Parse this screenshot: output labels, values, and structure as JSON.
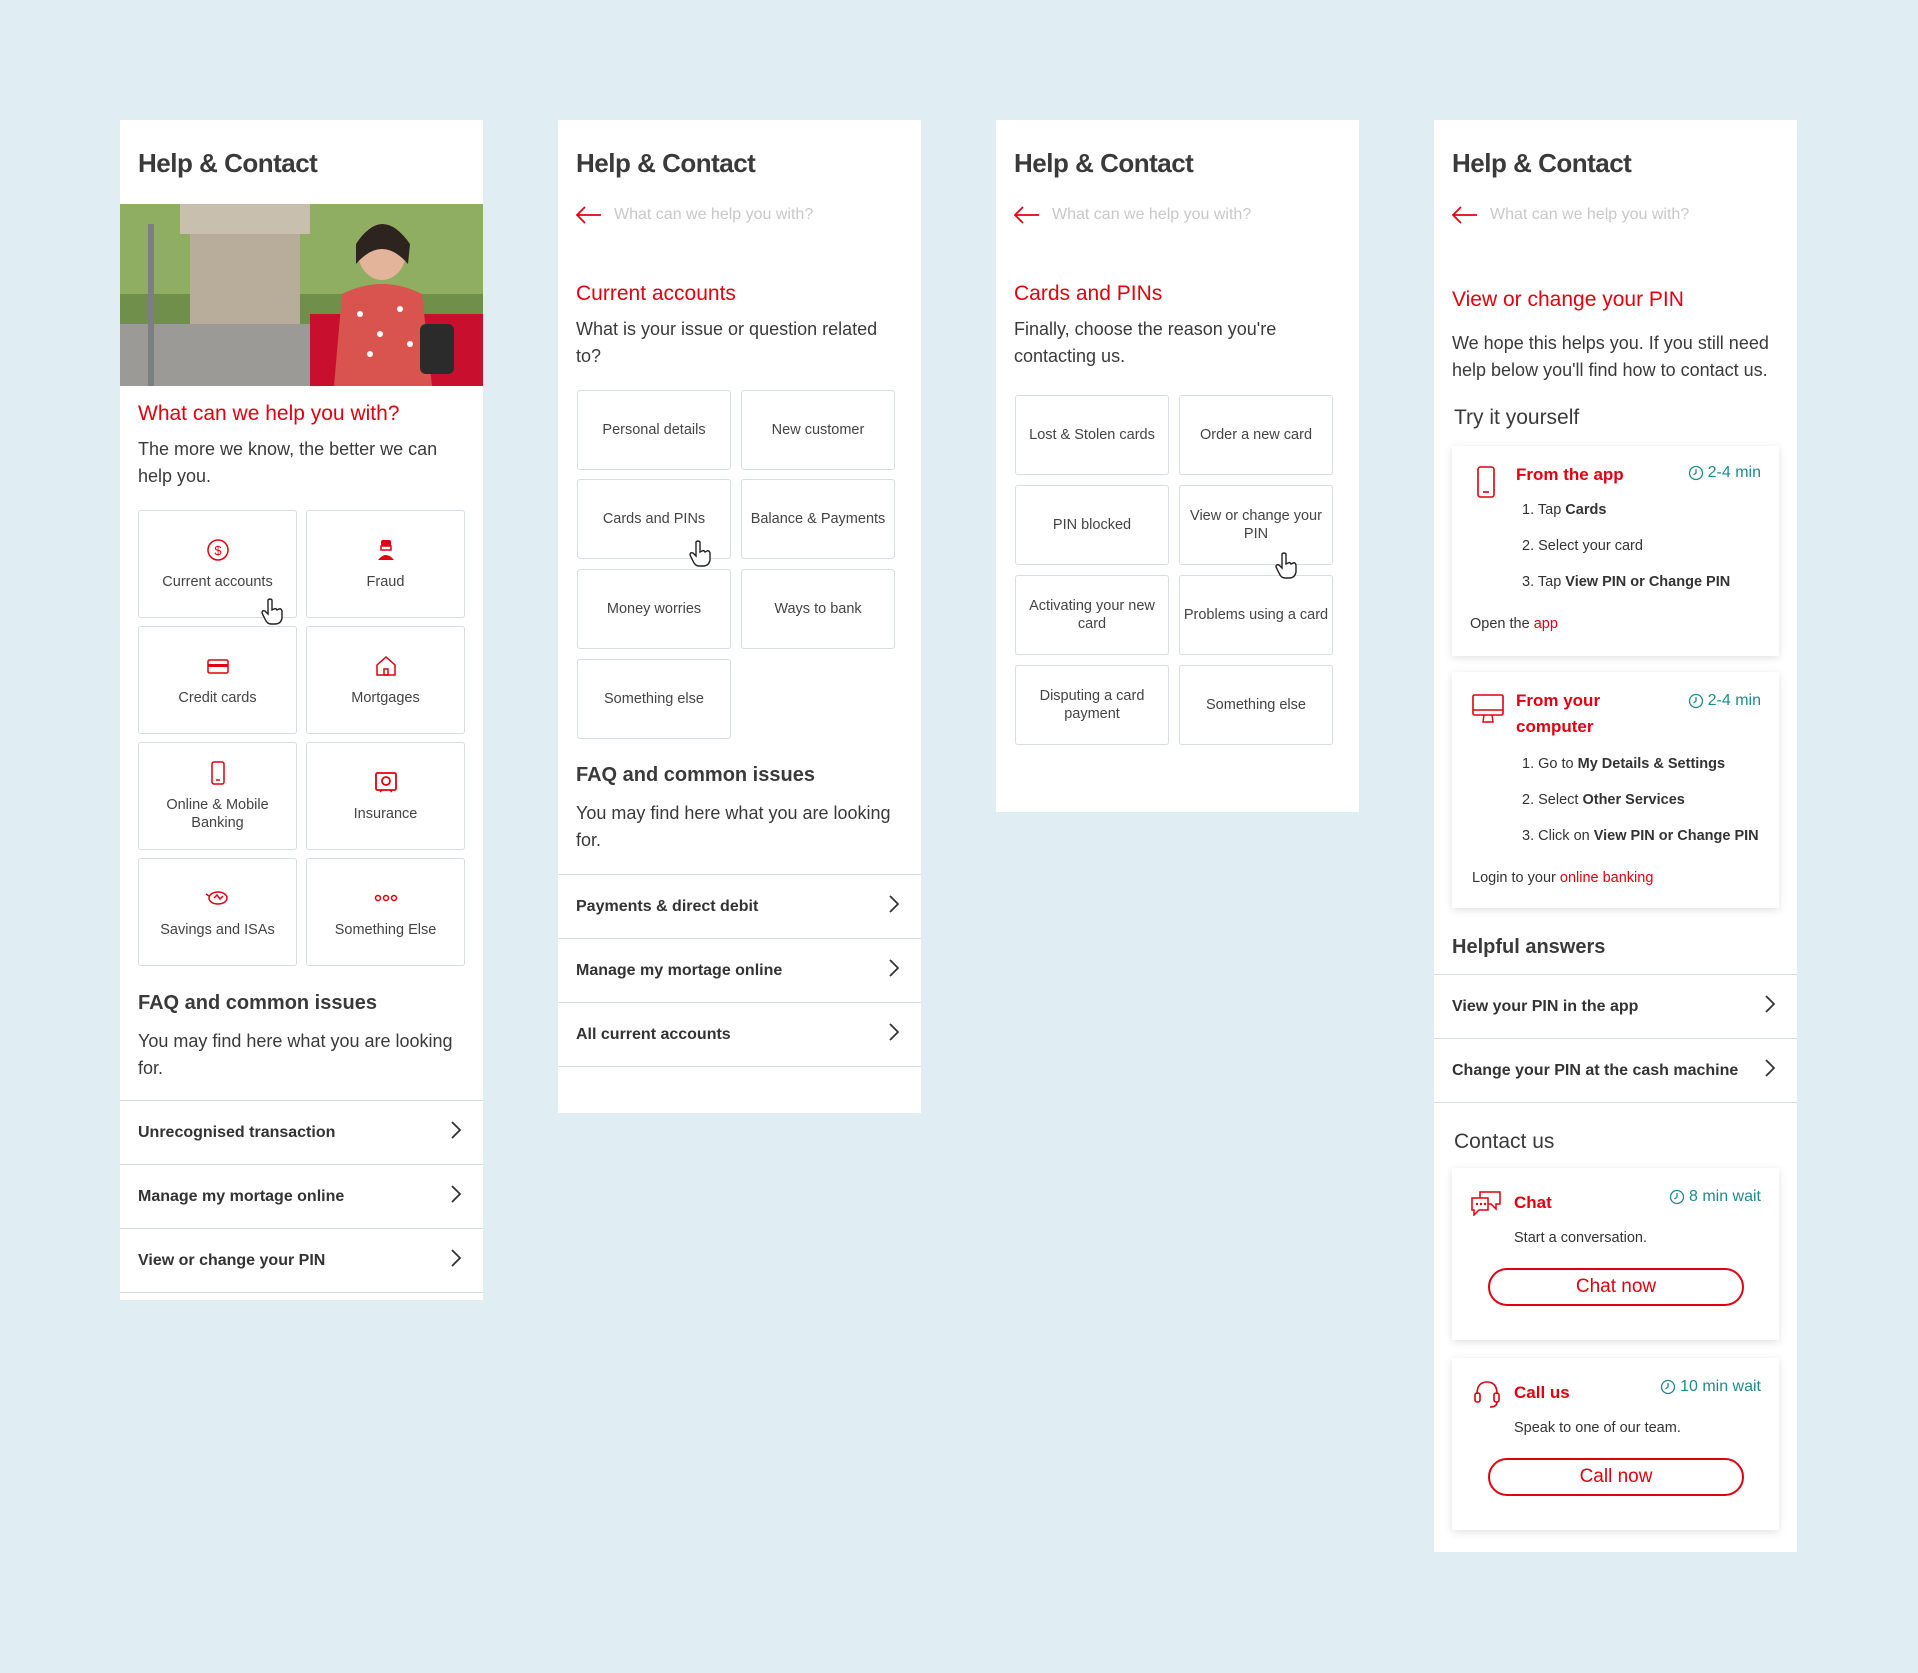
{
  "brand_color": "#e1000f",
  "screens": {
    "home": {
      "title": "Help & Contact",
      "heading": "What can we help you with?",
      "subtitle": "The more we know, the better we can help you.",
      "tiles": [
        {
          "label": "Current accounts",
          "icon": "dollar-circle-icon"
        },
        {
          "label": "Fraud",
          "icon": "fraudster-icon"
        },
        {
          "label": "Credit cards",
          "icon": "credit-card-icon"
        },
        {
          "label": "Mortgages",
          "icon": "house-icon"
        },
        {
          "label": "Online & Mobile Banking",
          "icon": "mobile-phone-icon"
        },
        {
          "label": "Insurance",
          "icon": "safe-icon"
        },
        {
          "label": "Savings and ISAs",
          "icon": "piggy-bank-icon"
        },
        {
          "label": "Something Else",
          "icon": "more-dots-icon"
        }
      ],
      "faq_title": "FAQ and common issues",
      "faq_subtitle": "You may find here what you are looking for.",
      "faq": [
        "Unrecognised transaction",
        "Manage my mortage online",
        "View or change your PIN"
      ]
    },
    "current_accounts": {
      "title": "Help & Contact",
      "back_label": "What can we help you with?",
      "heading": "Current accounts",
      "subtitle": "What is your issue or question related to?",
      "tiles": [
        "Personal details",
        "New customer",
        "Cards and PINs",
        "Balance & Payments",
        "Money worries",
        "Ways to bank",
        "Something else"
      ],
      "faq_title": "FAQ and common issues",
      "faq_subtitle": "You may find here what you are looking for.",
      "faq": [
        "Payments & direct debit",
        "Manage my mortage online",
        "All current accounts"
      ]
    },
    "cards_pins": {
      "title": "Help & Contact",
      "back_label": "What can we help you with?",
      "heading": "Cards and PINs",
      "subtitle": "Finally, choose the reason you're contacting us.",
      "tiles": [
        "Lost & Stolen cards",
        "Order a new card",
        "PIN blocked",
        "View or change your PIN",
        "Activating your new card",
        "Problems using a card",
        "Disputing a card payment",
        "Something else"
      ]
    },
    "pin": {
      "title": "Help & Contact",
      "back_label": "What can we help you with?",
      "heading": "View or change your PIN",
      "subtitle": "We hope this helps you. If you still need help below you'll find how to contact us.",
      "try_title": "Try it yourself",
      "app": {
        "title": "From the app",
        "time": "2-4 min",
        "steps": [
          {
            "num": "1.",
            "pre": "Tap ",
            "bold": "Cards"
          },
          {
            "num": "2.",
            "pre": "Select your card",
            "bold": ""
          },
          {
            "num": "3.",
            "pre": "Tap ",
            "bold": "View PIN or Change PIN"
          }
        ],
        "link_pre": "Open the ",
        "link": "app"
      },
      "computer": {
        "title_line1": "From your",
        "title_line2": "computer",
        "time": "2-4 min",
        "steps": [
          {
            "num": "1.",
            "pre": "Go to ",
            "bold": "My Details & Settings"
          },
          {
            "num": "2.",
            "pre": "Select ",
            "bold": "Other Services"
          },
          {
            "num": "3.",
            "pre": "Click on ",
            "bold": "View PIN or Change PIN"
          }
        ],
        "link_pre": "Login to your ",
        "link": "online banking"
      },
      "helpful_title": "Helpful answers",
      "helpful": [
        "View your PIN in the app",
        "Change your PIN at the cash machine"
      ],
      "contact_title": "Contact us",
      "chat": {
        "title": "Chat",
        "time": "8 min wait",
        "desc": "Start a conversation.",
        "button": "Chat now"
      },
      "call": {
        "title": "Call us",
        "time": "10 min wait",
        "desc": "Speak to one of our team.",
        "button": "Call now"
      }
    }
  }
}
